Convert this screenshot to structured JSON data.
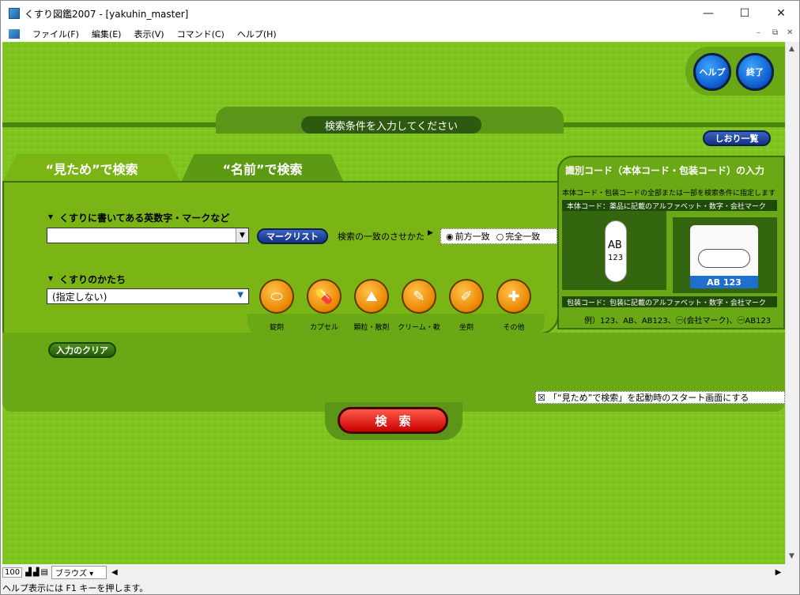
{
  "window": {
    "title": "くすり図鑑2007 - [yakuhin_master]",
    "minimize_glyph": "—",
    "maximize_glyph": "☐",
    "close_glyph": "✕"
  },
  "menu": [
    "ファイル(F)",
    "編集(E)",
    "表示(V)",
    "コマンド(C)",
    "ヘルプ(H)"
  ],
  "header": {
    "banner": "検索条件を入力してください",
    "help_button": "ヘルプ",
    "exit_button": "終了",
    "bookmark_button": "しおり一覧"
  },
  "tabs": {
    "appearance": "“見ため”で検索",
    "name": "“名前”で検索"
  },
  "appearance_search": {
    "code_label": "くすりに書いてある英数字・マークなど",
    "code_value": "",
    "mark_list_button": "マークリスト",
    "match_label": "検索の一致のさせかた",
    "match_options": [
      "前方一致",
      "完全一致"
    ],
    "match_selected": "前方一致",
    "shape_label": "くすりのかたち",
    "shape_value": "(指定しない)",
    "shapes": [
      "錠剤",
      "カプセル",
      "顆粒・散剤",
      "クリーム・軟膏",
      "坐剤",
      "その他"
    ],
    "clear_button": "入力のクリア"
  },
  "code_panel": {
    "title": "識別コード（本体コード・包装コード）の入力",
    "desc": "本体コード・包装コードの全部または一部を検索条件に指定します",
    "body_code_label": "本体コード：薬品に記載のアルファベット・数字・会社マーク",
    "body_code_top": "AB",
    "body_code_bottom": "123",
    "package_code_label": "包装コード：包装に記載のアルファベット・数字・会社マーク",
    "package_text": "AB 123",
    "example": "例）123、AB、AB123、㊀(会社マーク)、㊀AB123"
  },
  "startup_option": {
    "text": "「“見ため”で検索」を起動時のスタート画面にする",
    "checked": true
  },
  "search_button": "検　索",
  "status": {
    "zoom": "100",
    "browser_label": "ブラウズ",
    "hint": "ヘルプ表示には F1 キーを押します。"
  }
}
